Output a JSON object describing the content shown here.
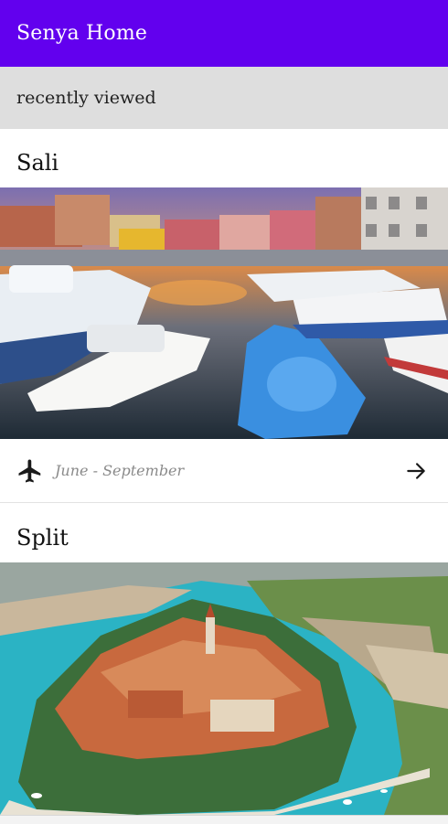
{
  "app": {
    "title": "Senya Home"
  },
  "section": {
    "title": "recently viewed"
  },
  "cards": [
    {
      "title": "Sali",
      "dates": "June - September",
      "plane_icon": "airplane-icon",
      "arrow_icon": "arrow-right-icon"
    },
    {
      "title": "Split"
    }
  ],
  "colors": {
    "appbar": "#6200ee",
    "section_bg": "#dedede"
  }
}
